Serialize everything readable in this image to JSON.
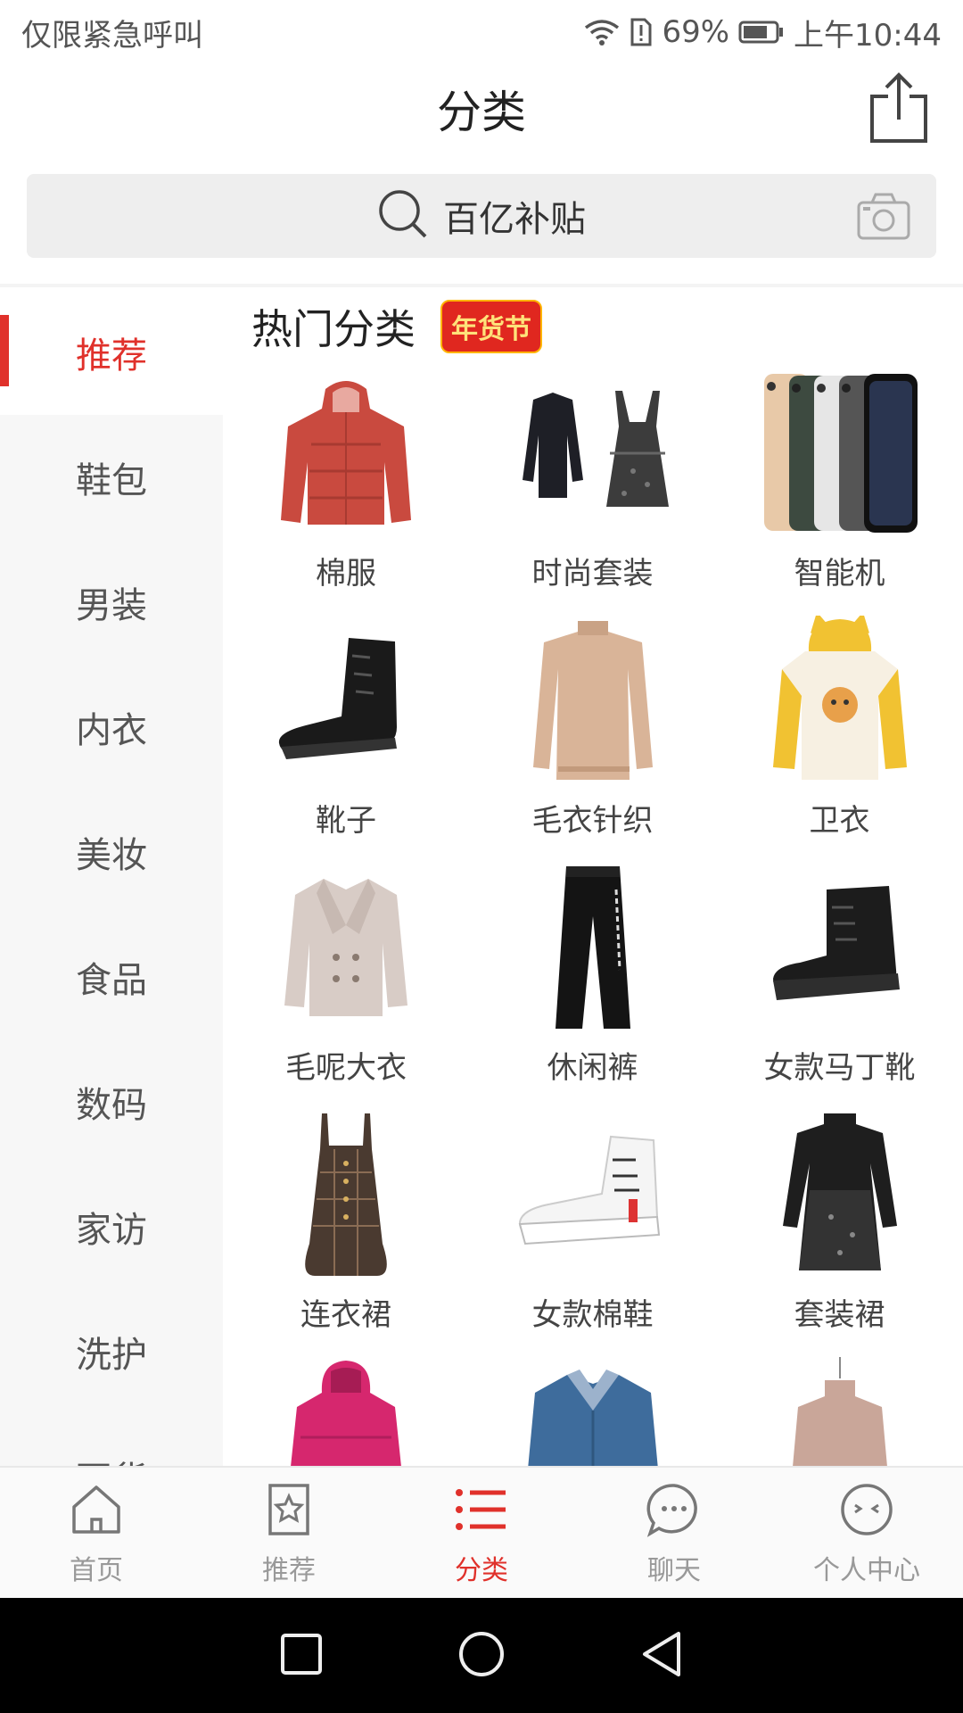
{
  "status_bar": {
    "carrier_text": "仅限紧急呼叫",
    "battery_percent": "69%",
    "time": "上午10:44"
  },
  "header": {
    "title": "分类"
  },
  "search": {
    "placeholder": "百亿补贴"
  },
  "sidebar": {
    "items": [
      {
        "label": "推荐",
        "active": true
      },
      {
        "label": "鞋包"
      },
      {
        "label": "男装"
      },
      {
        "label": "内衣"
      },
      {
        "label": "美妆"
      },
      {
        "label": "食品"
      },
      {
        "label": "数码"
      },
      {
        "label": "家访"
      },
      {
        "label": "洗护"
      },
      {
        "label": "百货"
      }
    ]
  },
  "section": {
    "title": "热门分类",
    "badge": "年货节"
  },
  "categories": [
    {
      "label": "棉服",
      "icon": "puffer-jacket-icon"
    },
    {
      "label": "时尚套装",
      "icon": "outfit-set-icon"
    },
    {
      "label": "智能机",
      "icon": "smartphone-icon"
    },
    {
      "label": "靴子",
      "icon": "boot-icon"
    },
    {
      "label": "毛衣针织",
      "icon": "sweater-icon"
    },
    {
      "label": "卫衣",
      "icon": "hoodie-icon"
    },
    {
      "label": "毛呢大衣",
      "icon": "wool-coat-icon"
    },
    {
      "label": "休闲裤",
      "icon": "pants-icon"
    },
    {
      "label": "女款马丁靴",
      "icon": "martin-boot-icon"
    },
    {
      "label": "连衣裙",
      "icon": "dress-icon"
    },
    {
      "label": "女款棉鞋",
      "icon": "sneaker-icon"
    },
    {
      "label": "套装裙",
      "icon": "suit-dress-icon"
    },
    {
      "label": "",
      "icon": "pink-jacket-icon"
    },
    {
      "label": "",
      "icon": "denim-jacket-icon"
    },
    {
      "label": "",
      "icon": "turtleneck-icon"
    }
  ],
  "bottom_nav": {
    "items": [
      {
        "label": "首页",
        "icon": "home-icon"
      },
      {
        "label": "推荐",
        "icon": "recommend-icon"
      },
      {
        "label": "分类",
        "icon": "category-icon",
        "active": true
      },
      {
        "label": "聊天",
        "icon": "chat-icon"
      },
      {
        "label": "个人中心",
        "icon": "profile-icon"
      }
    ]
  },
  "colors": {
    "accent": "#e0312b",
    "sidebar_bg": "#f7f7f7"
  }
}
